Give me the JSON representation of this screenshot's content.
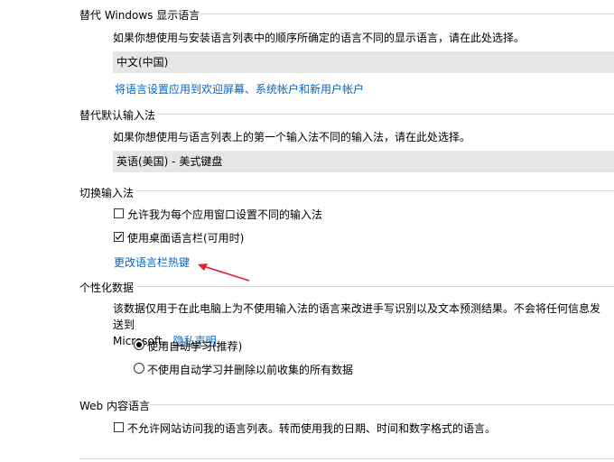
{
  "override_display_language": {
    "title": "替代 Windows 显示语言",
    "description": "如果你想使用与安装语言列表中的顺序所确定的语言不同的显示语言，请在此处选择。",
    "selected": "中文(中国)",
    "apply_link": "将语言设置应用到欢迎屏幕、系统帐户和新用户帐户"
  },
  "override_default_input": {
    "title": "替代默认输入法",
    "description": "如果你想使用与语言列表上的第一个输入法不同的输入法，请在此处选择。",
    "selected": "英语(美国) - 美式键盘"
  },
  "switch_input": {
    "title": "切换输入法",
    "checkbox_per_app": {
      "label": "允许我为每个应用窗口设置不同的输入法",
      "checked": false
    },
    "checkbox_langbar": {
      "label": "使用桌面语言栏(可用时)",
      "checked": true
    },
    "hotkeys_link": "更改语言栏热键"
  },
  "personalization": {
    "title": "个性化数据",
    "description": "该数据仅用于在此电脑上为不使用输入法的语言来改进手写识别以及文本预测结果。不会将任何信息发送到",
    "description_line2": "Microsoft。",
    "privacy_link": "隐私声明",
    "radio_auto": {
      "label": "使用自动学习(推荐)",
      "selected": true
    },
    "radio_off": {
      "label": "不使用自动学习并删除以前收集的所有数据",
      "selected": false
    }
  },
  "web_language": {
    "title": "Web 内容语言",
    "checkbox_block": {
      "label": "不允许网站访问我的语言列表。转而使用我的日期、时间和数字格式的语言。",
      "checked": false
    }
  },
  "colors": {
    "link": "#0066cc",
    "annotation_arrow": "#e0202a",
    "select_bg": "#e6e6e6"
  }
}
